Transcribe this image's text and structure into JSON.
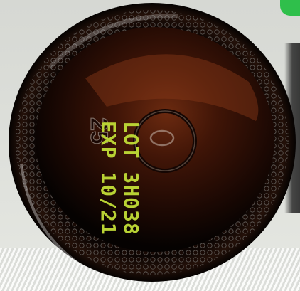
{
  "bottle_bottom": {
    "imprint": {
      "lot_line": "LOT 3H038",
      "exp_line": "EXP 10/21"
    },
    "mold_number": "25",
    "glass_color": "#3a1408",
    "print_color": "#b9d234"
  }
}
